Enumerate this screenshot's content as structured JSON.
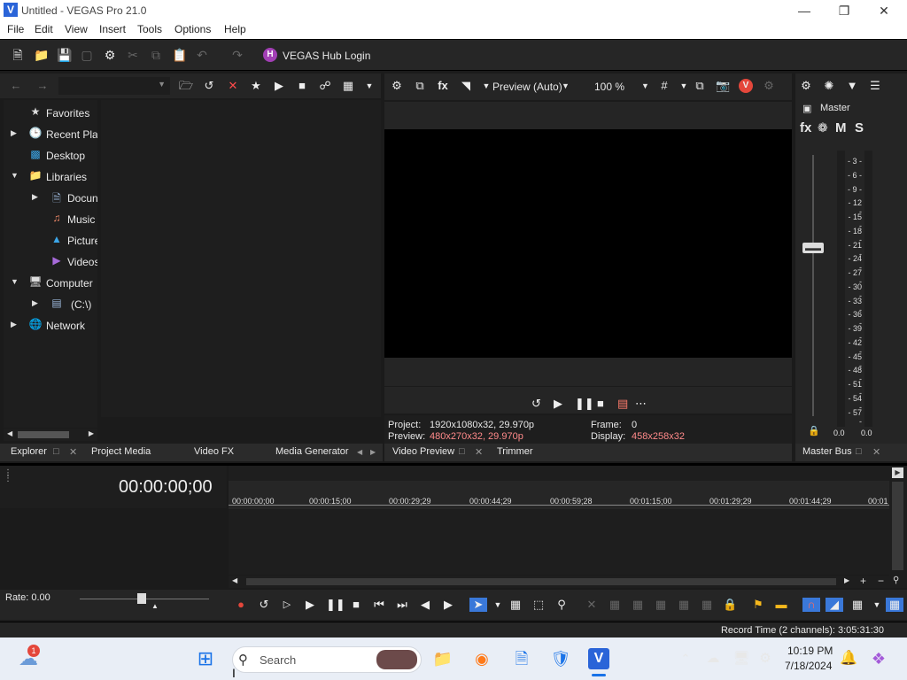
{
  "window": {
    "title": "Untitled - VEGAS Pro 21.0",
    "app_icon": "V"
  },
  "menu": [
    "File",
    "Edit",
    "View",
    "Insert",
    "Tools",
    "Options",
    "Help"
  ],
  "toolbar": {
    "hub_label": "VEGAS Hub Login"
  },
  "explorer": {
    "tree": [
      {
        "label": "Favorites"
      },
      {
        "label": "Recent Plac"
      },
      {
        "label": "Desktop"
      },
      {
        "label": "Libraries"
      },
      {
        "label": "Docun"
      },
      {
        "label": "Music"
      },
      {
        "label": "Picture"
      },
      {
        "label": "Videos"
      },
      {
        "label": "Computer"
      },
      {
        "label": "(C:\\)"
      },
      {
        "label": "Network"
      }
    ]
  },
  "left_tabs": [
    "Explorer",
    "Project Media",
    "Video FX",
    "Media Generator"
  ],
  "preview": {
    "mode": "Preview (Auto)",
    "zoom": "100 %",
    "project_label": "Project:",
    "project_value": "1920x1080x32, 29.970p",
    "preview_label": "Preview:",
    "preview_value": "480x270x32, 29.970p",
    "frame_label": "Frame:",
    "frame_value": "0",
    "display_label": "Display:",
    "display_value": "458x258x32"
  },
  "preview_tabs": [
    "Video Preview",
    "Trimmer"
  ],
  "master": {
    "label": "Master",
    "fx": "fx",
    "m": "M",
    "s": "S",
    "meter_ticks": [
      "3",
      "6",
      "9",
      "12",
      "15",
      "18",
      "21",
      "24",
      "27",
      "30",
      "33",
      "36",
      "39",
      "42",
      "45",
      "48",
      "51",
      "54",
      "57"
    ],
    "level_left": "0.0",
    "level_right": "0.0",
    "tab": "Master Bus"
  },
  "timeline": {
    "timecode": "00:00:00;00",
    "ruler": [
      "00:00:00;00",
      "00:00:15;00",
      "00:00:29;29",
      "00:00:44;29",
      "00:00:59;28",
      "00:01:15;00",
      "00:01:29;29",
      "00:01:44;29",
      "00:01"
    ],
    "rate": "Rate: 0.00"
  },
  "status": {
    "record_time": "Record Time (2 channels): 3:05:31:30"
  },
  "taskbar": {
    "search_placeholder": "Search",
    "time": "10:19 PM",
    "date": "7/18/2024",
    "weather_badge": "1"
  }
}
